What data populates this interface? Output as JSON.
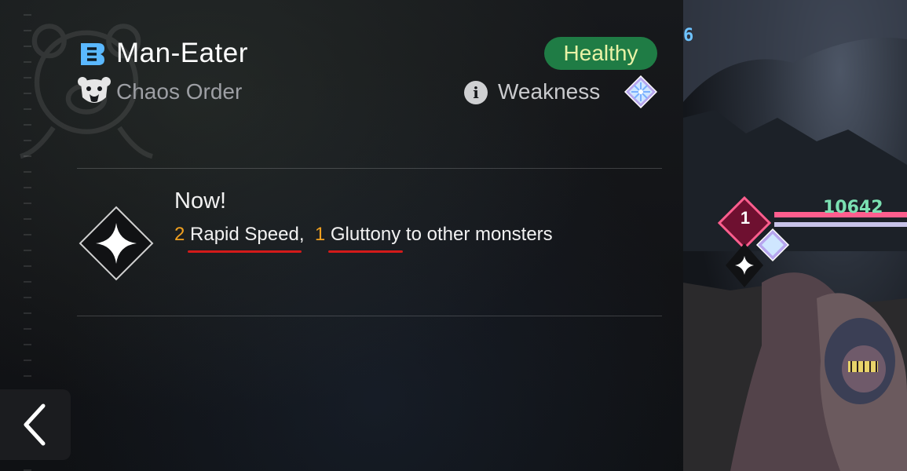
{
  "monster": {
    "rank": "B",
    "name": "Man-Eater",
    "faction": "Chaos Order",
    "status": "Healthy",
    "weakness_label": "Weakness",
    "weakness_icon": "ice-crystal-icon",
    "faction_icon": "bear-emblem-icon"
  },
  "skill": {
    "icon": "sparkle-star-icon",
    "timing": "Now!",
    "effects": [
      {
        "count": "2",
        "name": "Rapid Speed"
      },
      {
        "count": "1",
        "name": "Gluttony"
      }
    ],
    "separator": ", ",
    "suffix": " to other monsters"
  },
  "battle": {
    "turn_counter": "6",
    "level": "1",
    "hp": "10642"
  },
  "colors": {
    "status_bg": "#1f7c45",
    "status_text": "#e9f2a6",
    "highlight_number": "#f0a020",
    "underline": "#d31a1a",
    "rank_blue": "#5ab8ff",
    "hp_text": "#7be0b2",
    "hp_bar": "#ff5e8e"
  },
  "navigation": {
    "back_icon": "chevron-left-icon"
  }
}
